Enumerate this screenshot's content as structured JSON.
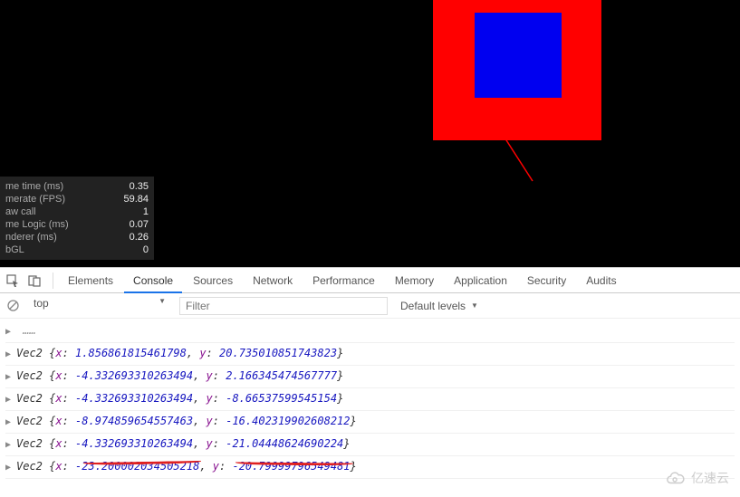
{
  "stats": {
    "rows": [
      {
        "label": "me time (ms)",
        "value": "0.35"
      },
      {
        "label": "merate (FPS)",
        "value": "59.84"
      },
      {
        "label": "aw call",
        "value": "1"
      },
      {
        "label": "me Logic (ms)",
        "value": "0.07"
      },
      {
        "label": "nderer (ms)",
        "value": "0.26"
      },
      {
        "label": "bGL",
        "value": "0"
      }
    ]
  },
  "tabs": {
    "items": [
      "Elements",
      "Console",
      "Sources",
      "Network",
      "Performance",
      "Memory",
      "Application",
      "Security",
      "Audits"
    ],
    "active": "Console"
  },
  "toolbar": {
    "context": "top",
    "filter_placeholder": "Filter",
    "levels": "Default levels"
  },
  "console": {
    "truncated_first": "…",
    "lines": [
      {
        "x": "1.856861815461798",
        "y": "20.735010851743823"
      },
      {
        "x": "-4.332693310263494",
        "y": "2.166345474567777"
      },
      {
        "x": "-4.332693310263494",
        "y": "-8.66537599545154"
      },
      {
        "x": "-8.974859654557463",
        "y": "-16.402319902608212"
      },
      {
        "x": "-4.332693310263494",
        "y": "-21.04448624690224"
      },
      {
        "x": "-23.200002034505218",
        "y": "-20.79999796549481"
      }
    ],
    "class_name": "Vec2"
  },
  "watermark": {
    "text": "亿速云"
  }
}
